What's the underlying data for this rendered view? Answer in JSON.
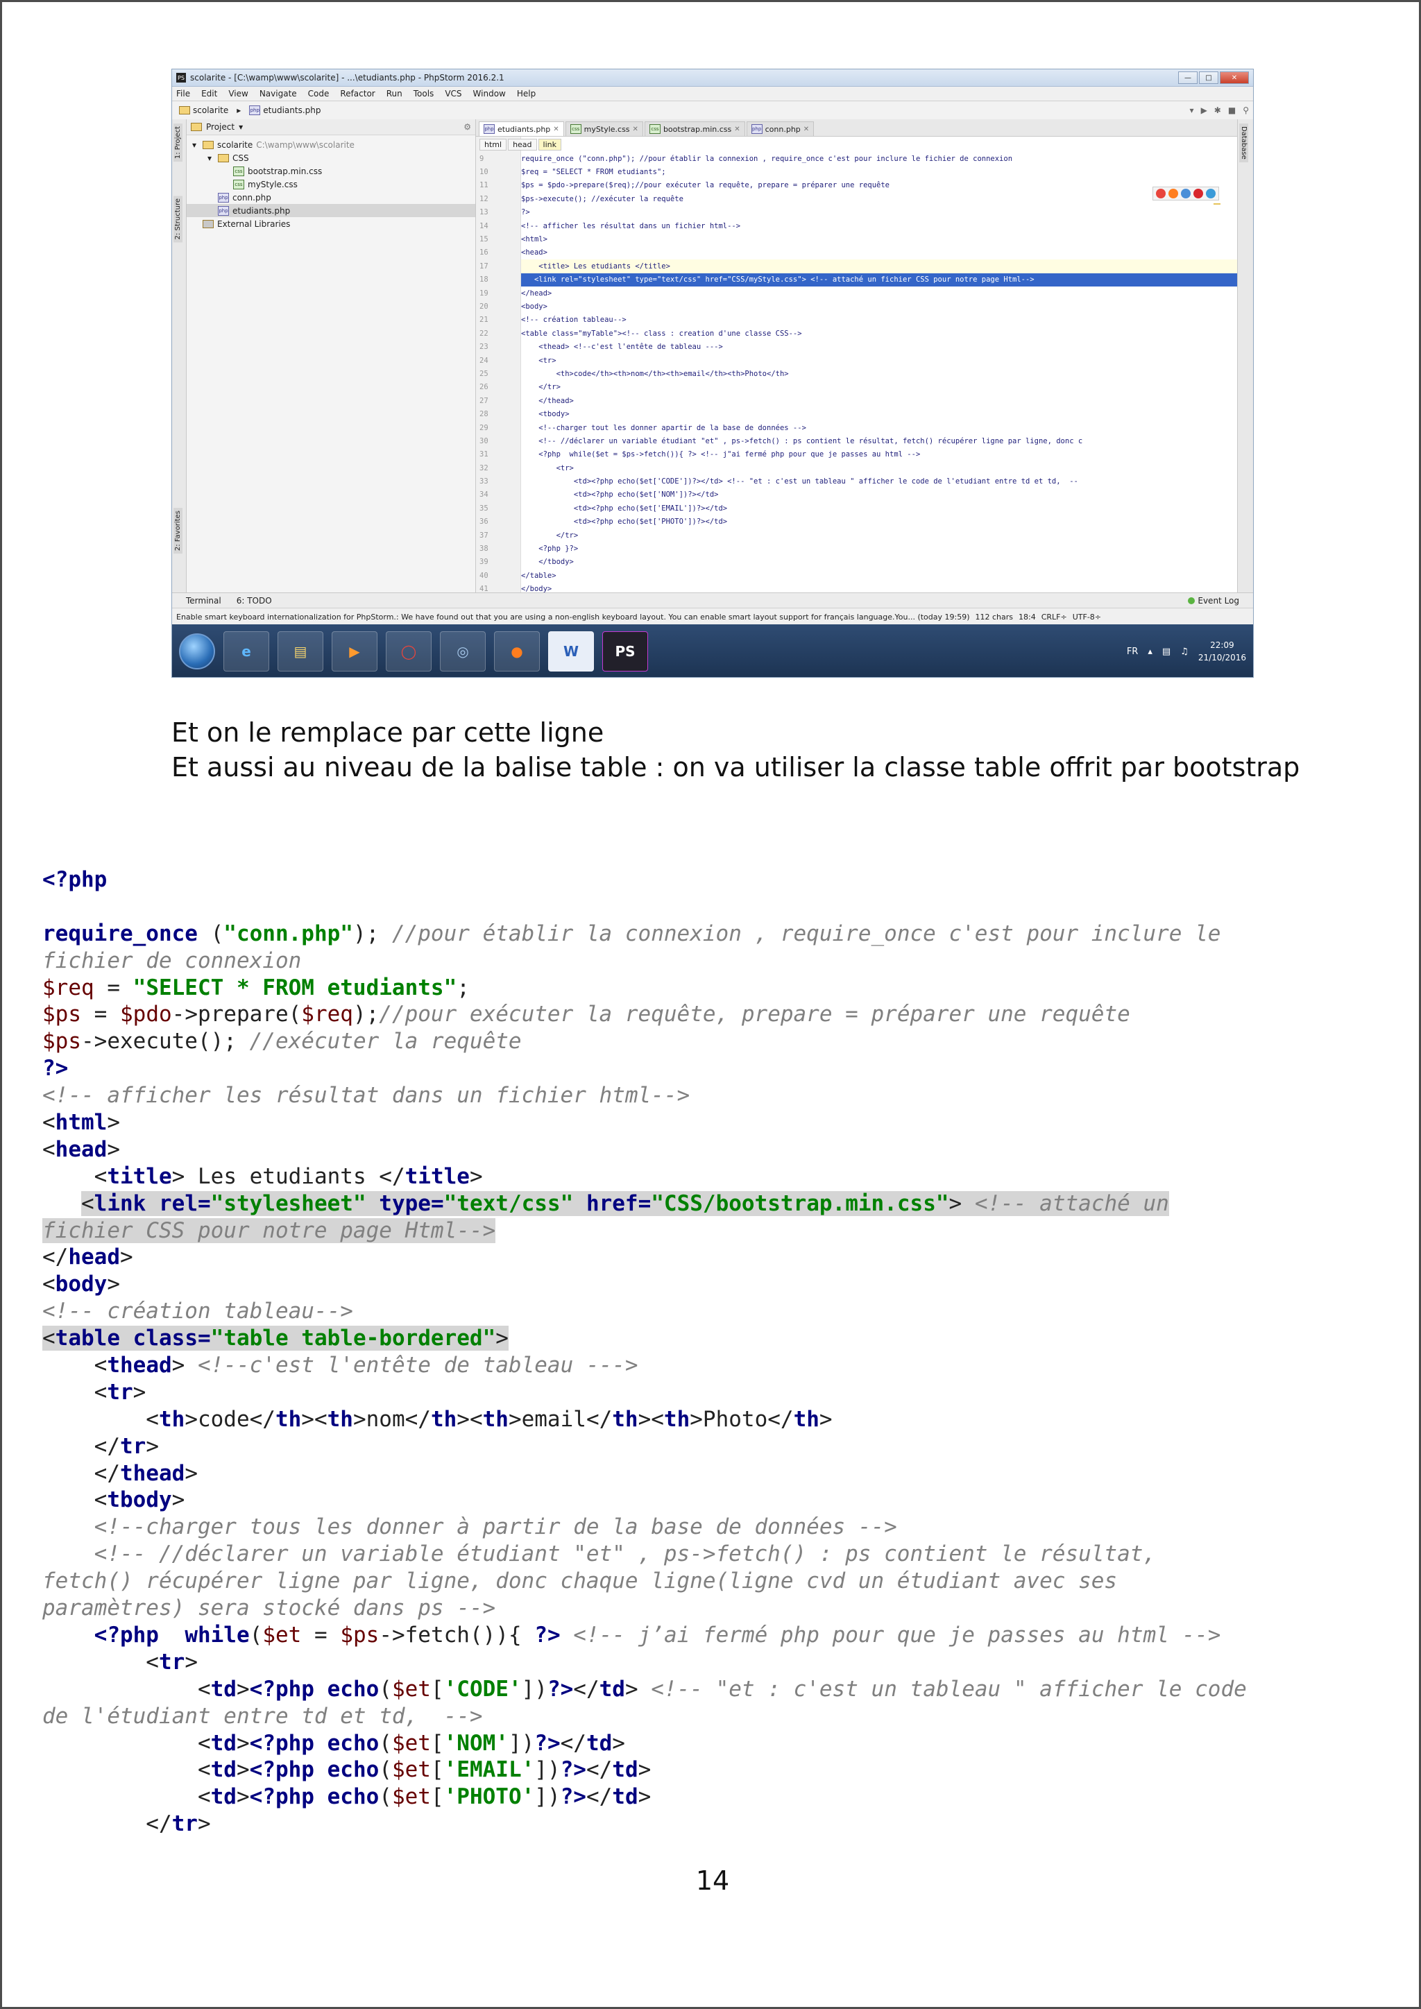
{
  "ide": {
    "window_title": "scolarite - [C:\\wamp\\www\\scolarite] - ...\\etudiants.php - PhpStorm 2016.2.1",
    "menu": [
      "File",
      "Edit",
      "View",
      "Navigate",
      "Code",
      "Refactor",
      "Run",
      "Tools",
      "VCS",
      "Window",
      "Help"
    ],
    "breadcrumb": [
      "scolarite",
      "etudiants.php"
    ],
    "project_panel_label": "Project",
    "left_tabs": [
      "1: Project",
      "2: Structure",
      "2: Favorites"
    ],
    "right_tab": "Database",
    "tree": [
      {
        "label": "scolarite",
        "path": "C:\\wamp\\www\\scolarite",
        "kind": "folder",
        "depth": 0
      },
      {
        "label": "CSS",
        "path": "",
        "kind": "folder",
        "depth": 1
      },
      {
        "label": "bootstrap.min.css",
        "path": "",
        "kind": "css",
        "depth": 2
      },
      {
        "label": "myStyle.css",
        "path": "",
        "kind": "css",
        "depth": 2
      },
      {
        "label": "conn.php",
        "path": "",
        "kind": "php",
        "depth": 1
      },
      {
        "label": "etudiants.php",
        "path": "",
        "kind": "php",
        "depth": 1
      },
      {
        "label": "External Libraries",
        "path": "",
        "kind": "lib",
        "depth": 0
      }
    ],
    "tabs": [
      {
        "label": "etudiants.php",
        "kind": "php",
        "active": true
      },
      {
        "label": "myStyle.css",
        "kind": "css",
        "active": false
      },
      {
        "label": "bootstrap.min.css",
        "kind": "css",
        "active": false
      },
      {
        "label": "conn.php",
        "kind": "php",
        "active": false
      }
    ],
    "code_crumbs": [
      "html",
      "head",
      "link"
    ],
    "code_lines": [
      {
        "n": "9",
        "text": "require_once (\"conn.php\"); //pour établir la connexion , require_once c'est pour inclure le fichier de connexion",
        "state": ""
      },
      {
        "n": "10",
        "text": "$req = \"SELECT * FROM etudiants\";",
        "state": ""
      },
      {
        "n": "11",
        "text": "$ps = $pdo->prepare($req);//pour exécuter la requête, prepare = préparer une requête",
        "state": ""
      },
      {
        "n": "12",
        "text": "$ps->execute(); //exécuter la requête",
        "state": ""
      },
      {
        "n": "13",
        "text": "?>",
        "state": ""
      },
      {
        "n": "14",
        "text": "<!-- afficher les résultat dans un fichier html-->",
        "state": ""
      },
      {
        "n": "15",
        "text": "<html>",
        "state": ""
      },
      {
        "n": "16",
        "text": "<head>",
        "state": ""
      },
      {
        "n": "17",
        "text": "    <title> Les etudiants </title>",
        "state": "caret"
      },
      {
        "n": "18",
        "text": "   <link rel=\"stylesheet\" type=\"text/css\" href=\"CSS/myStyle.css\"> <!-- attaché un fichier CSS pour notre page Html-->",
        "state": "sel"
      },
      {
        "n": "19",
        "text": "</head>",
        "state": ""
      },
      {
        "n": "20",
        "text": "<body>",
        "state": ""
      },
      {
        "n": "21",
        "text": "<!-- création tableau-->",
        "state": ""
      },
      {
        "n": "22",
        "text": "<table class=\"myTable\"><!-- class : creation d'une classe CSS-->",
        "state": ""
      },
      {
        "n": "23",
        "text": "    <thead> <!--c'est l'entête de tableau --->",
        "state": ""
      },
      {
        "n": "24",
        "text": "    <tr>",
        "state": ""
      },
      {
        "n": "25",
        "text": "        <th>code</th><th>nom</th><th>email</th><th>Photo</th>",
        "state": ""
      },
      {
        "n": "26",
        "text": "    </tr>",
        "state": ""
      },
      {
        "n": "27",
        "text": "    </thead>",
        "state": ""
      },
      {
        "n": "28",
        "text": "    <tbody>",
        "state": ""
      },
      {
        "n": "29",
        "text": "    <!--charger tout les donner apartir de la base de données -->",
        "state": ""
      },
      {
        "n": "30",
        "text": "    <!-- //déclarer un variable étudiant \"et\" , ps->fetch() : ps contient le résultat, fetch() récupérer ligne par ligne, donc c",
        "state": ""
      },
      {
        "n": "31",
        "text": "    <?php  while($et = $ps->fetch()){ ?> <!-- j\"ai fermé php pour que je passes au html -->",
        "state": ""
      },
      {
        "n": "32",
        "text": "        <tr>",
        "state": ""
      },
      {
        "n": "33",
        "text": "            <td><?php echo($et['CODE'])?></td> <!-- \"et : c'est un tableau \" afficher le code de l'etudiant entre td et td,  --",
        "state": ""
      },
      {
        "n": "34",
        "text": "            <td><?php echo($et['NOM'])?></td>",
        "state": ""
      },
      {
        "n": "35",
        "text": "            <td><?php echo($et['EMAIL'])?></td>",
        "state": ""
      },
      {
        "n": "36",
        "text": "            <td><?php echo($et['PHOTO'])?></td>",
        "state": ""
      },
      {
        "n": "37",
        "text": "        </tr>",
        "state": ""
      },
      {
        "n": "38",
        "text": "    <?php }?>",
        "state": ""
      },
      {
        "n": "39",
        "text": "    </tbody>",
        "state": ""
      },
      {
        "n": "40",
        "text": "</table>",
        "state": ""
      },
      {
        "n": "41",
        "text": "</body>",
        "state": ""
      }
    ],
    "bottom_tools": [
      "Terminal",
      "6: TODO"
    ],
    "event_log": "Event Log",
    "status_message": "Enable smart keyboard internationalization for PhpStorm.: We have found out that you are using a non-english keyboard layout. You can enable smart layout support for français language.You... (today 19:59)",
    "status_right": [
      "112 chars",
      "18:4",
      "CRLF÷",
      "UTF-8÷"
    ],
    "taskbar": {
      "apps": [
        "ie",
        "explorer",
        "media",
        "chrome",
        "hub",
        "firefox",
        "word",
        "phpstorm"
      ],
      "lang": "FR",
      "time": "22:09",
      "date": "21/10/2016"
    }
  },
  "paragraphs": [
    "Et on le remplace par cette ligne",
    "Et aussi au niveau de la balise table : on va utiliser la classe table offrit par bootstrap"
  ],
  "listing": {
    "open_tag": "<?php",
    "require_once": "require_once",
    "conn_file": "\"conn.php\"",
    "comment_connexion_1": "//pour établir la connexion , require_once c'est pour inclure le",
    "comment_connexion_2": "fichier de connexion",
    "req_var": "$req",
    "query": "\"SELECT * FROM etudiants\"",
    "ps_var": "$ps",
    "pdo_var": "$pdo",
    "prepare_call": "->prepare(",
    "comment_prepare": "//pour exécuter la requête, prepare = préparer une requête",
    "execute_call": "->execute();",
    "comment_execute": "//exécuter la requête",
    "close_tag": "?>",
    "comment_html": "<!-- afficher les résultat dans un fichier html-->",
    "html_tag": "html",
    "head_tag": "head",
    "title_tag": "title",
    "title_text": " Les etudiants ",
    "link_tag": "link",
    "rel_attr": "rel=",
    "rel_val": "\"stylesheet\"",
    "type_attr": "type=",
    "type_val": "\"text/css\"",
    "href_attr": "href=",
    "href_val": "\"CSS/bootstrap.min.css\"",
    "comment_link_1": "<!-- attaché un",
    "comment_link_2": "fichier CSS pour notre page Html-->",
    "body_tag": "body",
    "comment_table": "<!-- création tableau-->",
    "table_tag": "table",
    "class_attr": "class=",
    "class_val": "\"table table-bordered\"",
    "thead_tag": "thead",
    "comment_thead": "<!--c'est l'entête de tableau --->",
    "tr_tag": "tr",
    "th_tag": "th",
    "th_values": [
      "code",
      "nom",
      "email",
      "Photo"
    ],
    "tbody_tag": "tbody",
    "comment_load": "<!--charger tous les donner à partir de la base de données -->",
    "comment_decl_1": "<!-- //déclarer un variable étudiant \"et\" , ps->fetch() : ps contient le résultat,",
    "comment_decl_2": "fetch() récupérer ligne par ligne, donc chaque ligne(ligne cvd un étudiant avec ses",
    "comment_decl_3": "paramètres) sera stocké dans ps -->",
    "php_open": "<?php",
    "while_kw": "while",
    "et_var": "$et",
    "fetch_call": "->fetch()){",
    "comment_while": "<!-- j’ai fermé php pour que je passes au html -->",
    "td_tag": "td",
    "echo_kw": "echo",
    "keys": [
      "'CODE'",
      "'NOM'",
      "'EMAIL'",
      "'PHOTO'"
    ],
    "comment_td_1": "<!-- \"et : c'est un tableau \" afficher le code",
    "comment_td_2": "de l'étudiant entre td et td,  -->"
  },
  "page_number": "14"
}
